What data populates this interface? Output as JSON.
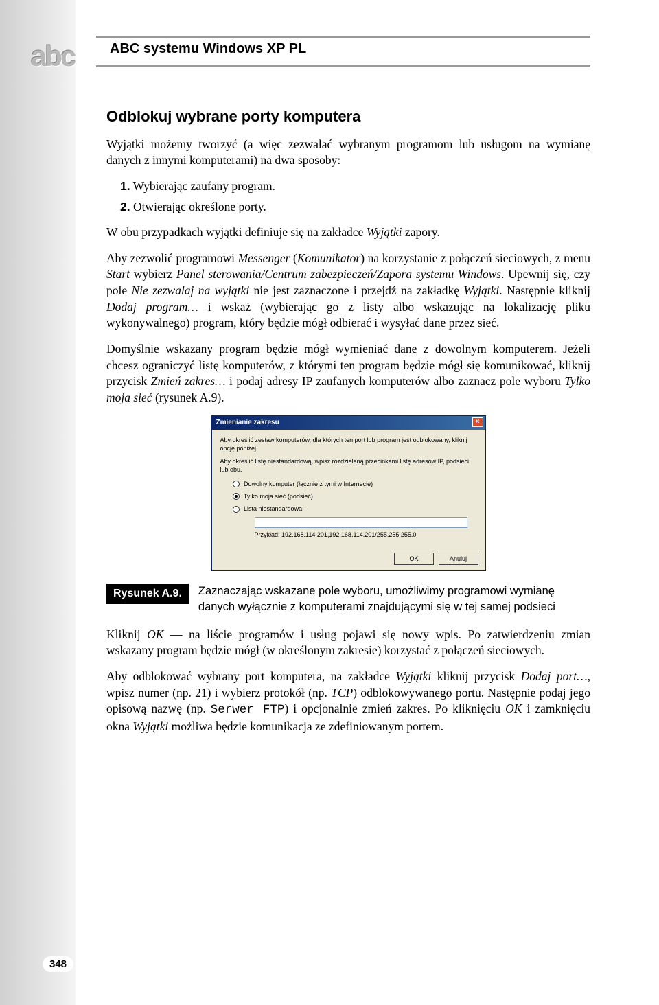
{
  "header": {
    "logo": "abc",
    "title": "ABC systemu Windows XP PL"
  },
  "section": {
    "title": "Odblokuj wybrane porty komputera",
    "intro": "Wyjątki możemy tworzyć (a więc zezwalać wybranym programom lub usługom na wymianę danych z innymi komputerami) na dwa sposoby:",
    "item1_num": "1.",
    "item1": "Wybierając zaufany program.",
    "item2_num": "2.",
    "item2": "Otwierając określone porty.",
    "p_both_before": "W obu przypadkach wyjątki definiuje się na zakładce ",
    "p_both_italic": "Wyjątki",
    "p_both_after": " zapory.",
    "p_allow": "Aby zezwolić programowi <i>Messenger</i> (<i>Komunikator</i>) na korzystanie z połączeń sieciowych, z menu <i>Start</i> wybierz <i>Panel sterowania/Centrum zabezpieczeń/Zapora systemu Windows</i>. Upewnij się, czy pole <i>Nie zezwalaj na wyjątki</i> nie jest zaznaczone i przejdź na zakładkę <i>Wyjątki</i>. Następnie kliknij <i>Dodaj program…</i> i wskaż (wybierając go z listy albo wskazując na lokalizację pliku wykonywalnego) program, który będzie mógł odbierać i wysyłać dane przez sieć.",
    "p_default": "Domyślnie wskazany program będzie mógł wymieniać dane z dowolnym komputerem. Jeżeli chcesz ograniczyć listę komputerów, z którymi ten program będzie mógł się komunikować, kliknij przycisk <i>Zmień zakres…</i> i podaj adresy IP zaufanych komputerów albo zaznacz pole wyboru <i>Tylko moja sieć</i> (rysunek A.9).",
    "p_click_ok": "Kliknij <i>OK</i> — na liście programów i usług pojawi się nowy wpis. Po zatwierdzeniu zmian wskazany program będzie mógł (w określonym zakresie) korzystać z połączeń sieciowych.",
    "p_unblock_port": "Aby odblokować wybrany port komputera, na zakładce <i>Wyjątki</i> kliknij przycisk <i>Dodaj port…</i>, wpisz numer (np. 21) i wybierz protokół (np. <i>TCP</i>) odblokowywanego portu. Następnie podaj jego opisową nazwę (np. <span class=\"mono\">Serwer FTP</span>) i opcjonalnie zmień zakres. Po kliknięciu <i>OK</i> i zamknięciu okna <i>Wyjątki</i> możliwa będzie komunikacja ze zdefiniowanym portem."
  },
  "dialog": {
    "title": "Zmienianie zakresu",
    "note1": "Aby określić zestaw komputerów, dla których ten port lub program jest odblokowany, kliknij opcję poniżej.",
    "note2": "Aby określić listę niestandardową, wpisz rozdzielaną przecinkami listę adresów IP, podsieci lub obu.",
    "opt1": "Dowolny komputer (łącznie z tymi w Internecie)",
    "opt2": "Tylko moja sieć (podsieć)",
    "opt3": "Lista niestandardowa:",
    "example": "Przykład: 192.168.114.201,192.168.114.201/255.255.255.0",
    "ok": "OK",
    "cancel": "Anuluj",
    "close": "×"
  },
  "figure": {
    "label": "Rysunek A.9.",
    "caption": "Zaznaczając wskazane pole wyboru, umożliwimy programowi wymianę danych wyłącznie z komputerami znajdującymi się w tej samej podsieci"
  },
  "page_number": "348"
}
